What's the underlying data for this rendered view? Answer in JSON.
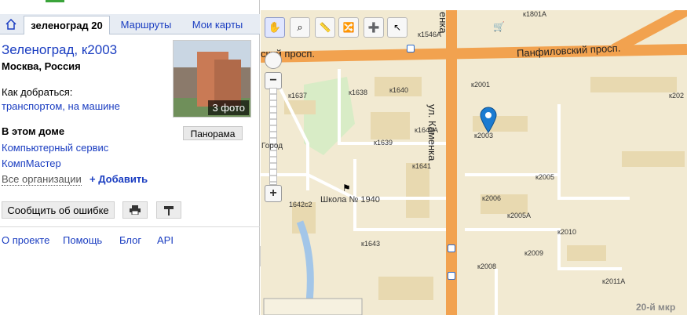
{
  "tabs": {
    "home_icon": "home-icon",
    "items": [
      {
        "label": "зеленоград 20"
      },
      {
        "label": "Маршруты"
      },
      {
        "label": "Мои карты"
      }
    ]
  },
  "place": {
    "title": "Зеленоград, к2003",
    "city": "Москва, Россия",
    "photo_count": "3 фото",
    "panorama_label": "Панорама",
    "how_to_get": "Как добраться:",
    "by_transport": "транспортом",
    "by_car": "на машине",
    "in_building": "В этом доме",
    "orgs": [
      "Компьютерный сервис",
      "КомпМастер"
    ],
    "all_orgs": "Все организации",
    "add": "+ Добавить",
    "report_error": "Сообщить об ошибке"
  },
  "footer": [
    "О проекте",
    "Помощь",
    "Блог",
    "API"
  ],
  "map": {
    "zoom_label": "Город",
    "streets": {
      "panfilovsky": "Панфиловский просп.",
      "panfilovsky_left": "ский просп.",
      "kamenka": "ул. Каменка",
      "kamenka_top": "енка"
    },
    "school": "Школа № 1940",
    "district": "20-й мкр",
    "buildings": [
      "к1801А",
      "к1546А",
      "к2001",
      "к1637",
      "к1638",
      "к1640",
      "к1640А",
      "к1639",
      "к1641",
      "к2003",
      "к2005",
      "к2006",
      "к2005А",
      "к2010",
      "к2009",
      "к2008",
      "к2011А",
      "1642с2",
      "к1643",
      "к202"
    ]
  }
}
